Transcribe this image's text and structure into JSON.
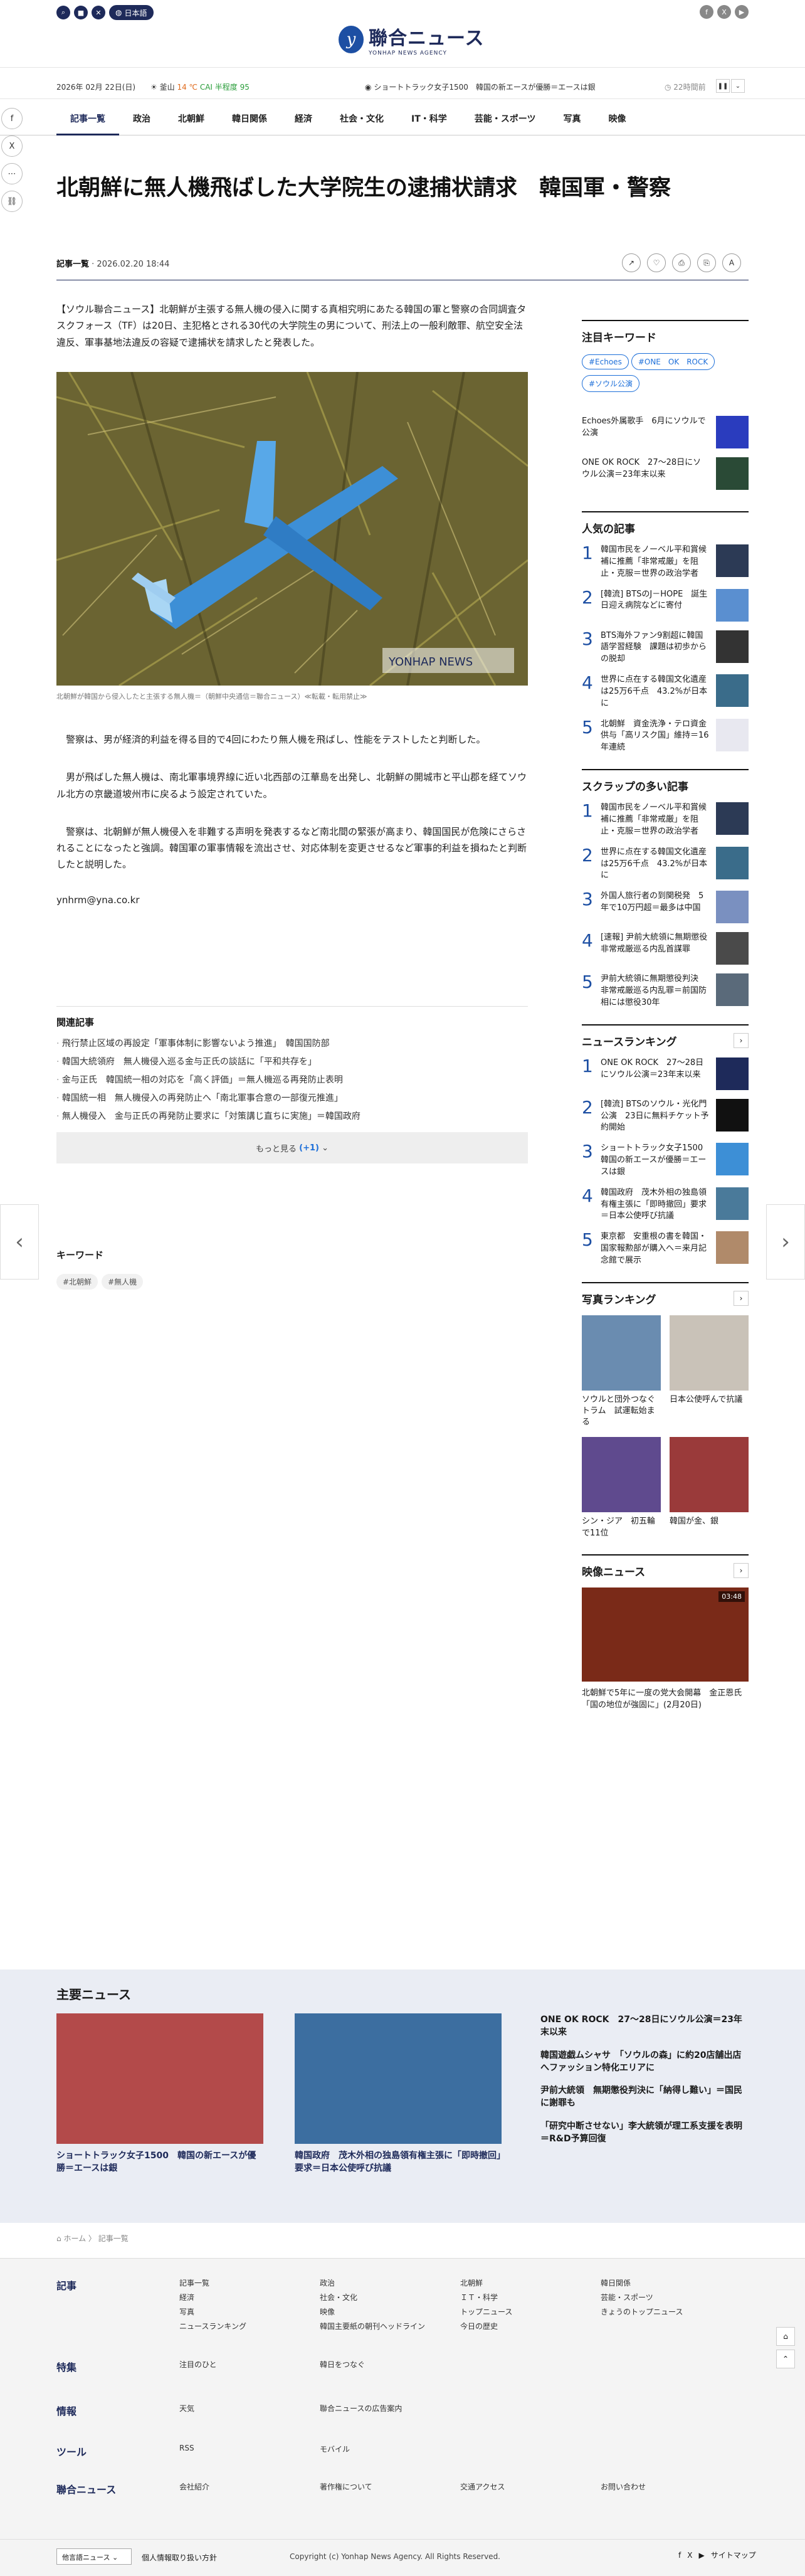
{
  "top": {
    "lang": "日本語",
    "logo_jp": "聯合ニュース",
    "logo_en": "YONHAP NEWS AGENCY"
  },
  "info": {
    "date": "2026年 02月 22日(日)",
    "weather_city": "釜山",
    "weather_temp": "14 ℃",
    "weather_cai": "CAI 半程度 95",
    "ticker": "ショートトラック女子1500　韓国の新エースが優勝＝エースは銀",
    "ago": "22時間前"
  },
  "nav": [
    "記事一覧",
    "政治",
    "北朝鮮",
    "韓日関係",
    "経済",
    "社会・文化",
    "IT・科学",
    "芸能・スポーツ",
    "写真",
    "映像"
  ],
  "article": {
    "title": "北朝鮮に無人機飛ばした大学院生の逮捕状請求　韓国軍・警察",
    "section": "記事一覧",
    "datetime": "2026.02.20 18:44",
    "lead": "【ソウル聯合ニュース】北朝鮮が主張する無人機の侵入に関する真相究明にあたる韓国の軍と警察の合同調査タスクフォース（TF）は20日、主犯格とされる30代の大学院生の男について、刑法上の一般利敵罪、航空安全法違反、軍事基地法違反の容疑で逮捕状を請求したと発表した。",
    "photo_caption": "北朝鮮が韓国から侵入したと主張する無人機＝（朝鮮中央通信＝聯合ニュース）≪転載・転用禁止≫",
    "photo_watermark": "YONHAP NEWS",
    "p1": "　警察は、男が経済的利益を得る目的で4回にわたり無人機を飛ばし、性能をテストしたと判断した。",
    "p2": "　男が飛ばした無人機は、南北軍事境界線に近い北西部の江華島を出発し、北朝鮮の開城市と平山郡を経てソウル北方の京畿道坡州市に戻るよう設定されていた。",
    "p3": "　警察は、北朝鮮が無人機侵入を非難する声明を発表するなど南北間の緊張が高まり、韓国国民が危険にさらされることになったと強調。韓国軍の軍事情報を流出させ、対応体制を変更させるなど軍事的利益を損ねたと判断したと説明した。",
    "email": "ynhrm@yna.co.kr"
  },
  "related": {
    "title": "関連記事",
    "items": [
      "飛行禁止区域の再設定「軍事体制に影響ないよう推進」　韓国国防部",
      "韓国大統領府　無人機侵入巡る金与正氏の談話に「平和共存を」",
      "金与正氏　韓国統一相の対応を「高く評価」＝無人機巡る再発防止表明",
      "韓国統一相　無人機侵入の再発防止へ「南北軍事合意の一部復元推進」",
      "無人機侵入　金与正氏の再発防止要求に「対策講じ直ちに実施」＝韓国政府"
    ],
    "more_label": "もっと見る",
    "more_count": "(+1)"
  },
  "keyword": {
    "title": "キーワード",
    "tags": [
      "#北朝鮮",
      "#無人機"
    ]
  },
  "sidebar": {
    "hot_title": "注目キーワード",
    "pills": [
      "#Echoes",
      "#ONE　OK　ROCK",
      "#ソウル公演"
    ],
    "hot_items": [
      "Echoes外属歌手　6月にソウルで公演",
      "ONE OK ROCK　27～28日にソウル公演＝23年末以来"
    ],
    "popular_title": "人気の記事",
    "popular": [
      "韓国市民をノーベル平和賞候補に推薦「非常戒厳」を阻止・克服＝世界の政治学者",
      "[韓流] BTSのJ－HOPE　誕生日迎え病院などに寄付",
      "BTS海外ファン9割超に韓国語学習経験　課題は初歩からの脱却",
      "世界に点在する韓国文化遺産は25万6千点　43.2%が日本に",
      "北朝鮮　資金洗浄・テロ資金供与「高リスク国」維持＝16年連続"
    ],
    "scrap_title": "スクラップの多い記事",
    "scrap": [
      "韓国市民をノーベル平和賞候補に推薦「非常戒厳」を阻止・克服＝世界の政治学者",
      "世界に点在する韓国文化遺産は25万6千点　43.2%が日本に",
      "外国人旅行者の到関税発　5年で10万円超＝最多は中国",
      "[速報] 尹前大統領に無期懲役　非常戒厳巡る内乱首謀罪",
      "尹前大統領に無期懲役判決　非常戒厳巡る内乱罪＝前国防相には懲役30年"
    ],
    "ranking_title": "ニュースランキング",
    "ranking": [
      "ONE OK ROCK　27～28日にソウル公演＝23年末以来",
      "[韓流] BTSのソウル・光化門公演　23日に無料チケット予約開始",
      "ショートトラック女子1500　韓国の新エースが優勝＝エースは銀",
      "韓国政府　茂木外相の独島領有権主張に「即時撤回」要求＝日本公使呼び抗議",
      "東京都　安重根の書を韓国・国家報勲部が購入へ＝来月記念館で展示"
    ],
    "photo_title": "写真ランキング",
    "photos": [
      "ソウルと団外つなぐトラム　試運転始まる",
      "日本公使呼んで抗議",
      "シン・ジア　初五輪で11位",
      "韓国が金、銀"
    ],
    "video_title": "映像ニュース",
    "video_time": "03:48",
    "video_text": "北朝鮮で5年に一度の党大会開幕　金正恩氏「国の地位が強固に」(2月20日)"
  },
  "main_news": {
    "title": "主要ニュース",
    "cards": [
      "ショートトラック女子1500　韓国の新エースが優勝＝エースは銀",
      "韓国政府　茂木外相の独島領有権主張に「即時撤回」要求＝日本公使呼び抗議"
    ],
    "list": [
      "ONE OK ROCK　27～28日にソウル公演＝23年末以来",
      "韓国遊戯ムシャサ　「ソウルの森」に約20店舗出店へファッション特化エリアに",
      "尹前大統領　無期懲役判決に「納得し難い」＝国民に謝罪も",
      "「研究中断させない」李大統領が理工系支援を表明＝R&D予算回復"
    ]
  },
  "breadcrumb": {
    "home": "ホーム",
    "current": "記事一覧"
  },
  "footer": {
    "sections": [
      {
        "h": "記事",
        "links": [
          "記事一覧",
          "政治",
          "北朝鮮",
          "韓日関係",
          "経済",
          "社会・文化",
          "ＩＴ・科学",
          "芸能・スポーツ",
          "写真",
          "映像",
          "トップニュース",
          "きょうのトップニュース",
          "ニュースランキング",
          "韓国主要紙の朝刊ヘッドライン",
          "今日の歴史",
          ""
        ]
      },
      {
        "h": "特集",
        "links": [
          "注目のひと",
          "韓日をつなぐ"
        ]
      },
      {
        "h": "情報",
        "links": [
          "天気",
          "聯合ニュースの広告案内"
        ]
      },
      {
        "h": "ツール",
        "links": [
          "RSS",
          "モバイル"
        ]
      },
      {
        "h": "聯合ニュース",
        "links": [
          "会社紹介",
          "著作権について",
          "交通アクセス",
          "お問い合わせ"
        ]
      }
    ],
    "family": "他言語ニュース",
    "privacy": "個人情報取り扱い方針",
    "copyright": "Copyright (c) Yonhap News Agency. All Rights Reserved.",
    "sitemap": "サイトマップ"
  }
}
